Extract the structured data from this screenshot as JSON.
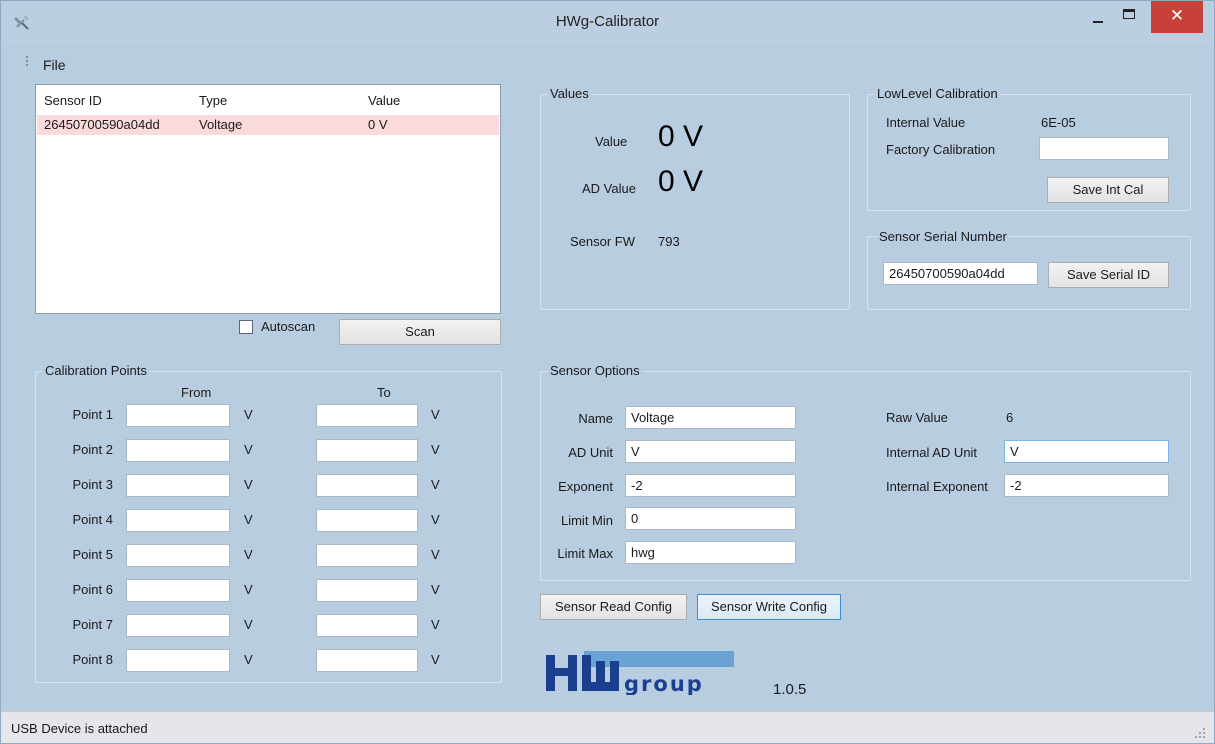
{
  "window": {
    "title": "HWg-Calibrator",
    "close_glyph": "✕"
  },
  "menu": {
    "file": "File"
  },
  "sensor_list": {
    "columns": [
      "Sensor ID",
      "Type",
      "Value"
    ],
    "rows": [
      {
        "id": "26450700590a04dd",
        "type": "Voltage",
        "value": "0 V",
        "selected": true
      }
    ]
  },
  "scan": {
    "autoscan_label": "Autoscan",
    "autoscan_checked": false,
    "scan_button": "Scan"
  },
  "values": {
    "title": "Values",
    "value_label": "Value",
    "value": "0 V",
    "ad_value_label": "AD Value",
    "ad_value": "0 V",
    "fw_label": "Sensor FW",
    "fw": "793"
  },
  "lowlevel": {
    "title": "LowLevel Calibration",
    "internal_value_label": "Internal Value",
    "internal_value": "6E-05",
    "factory_label": "Factory Calibration",
    "factory_value": "",
    "save_button": "Save Int Cal"
  },
  "serial": {
    "title": "Sensor Serial Number",
    "value": "26450700590a04dd",
    "save_button": "Save Serial ID"
  },
  "calibration": {
    "title": "Calibration Points",
    "from_header": "From",
    "to_header": "To",
    "unit": "V",
    "points": [
      {
        "label": "Point 1",
        "from": "",
        "to": ""
      },
      {
        "label": "Point 2",
        "from": "",
        "to": ""
      },
      {
        "label": "Point 3",
        "from": "",
        "to": ""
      },
      {
        "label": "Point 4",
        "from": "",
        "to": ""
      },
      {
        "label": "Point 5",
        "from": "",
        "to": ""
      },
      {
        "label": "Point 6",
        "from": "",
        "to": ""
      },
      {
        "label": "Point 7",
        "from": "",
        "to": ""
      },
      {
        "label": "Point 8",
        "from": "",
        "to": ""
      }
    ]
  },
  "options": {
    "title": "Sensor Options",
    "name_label": "Name",
    "name": "Voltage",
    "ad_unit_label": "AD Unit",
    "ad_unit": "V",
    "exponent_label": "Exponent",
    "exponent": "-2",
    "limit_min_label": "Limit Min",
    "limit_min": "0",
    "limit_max_label": "Limit Max",
    "limit_max": "hwg",
    "raw_value_label": "Raw Value",
    "raw_value": "6",
    "internal_ad_unit_label": "Internal AD Unit",
    "internal_ad_unit": "V",
    "internal_exponent_label": "Internal Exponent",
    "internal_exponent": "-2"
  },
  "actions": {
    "read": "Sensor Read Config",
    "write": "Sensor Write Config"
  },
  "brand": {
    "logo_text_hw": "HW",
    "logo_text_group": "group",
    "version": "1.0.5",
    "color": "#1b3f8f",
    "accent": "#6aa2d4"
  },
  "status": {
    "text": "USB Device is attached"
  }
}
